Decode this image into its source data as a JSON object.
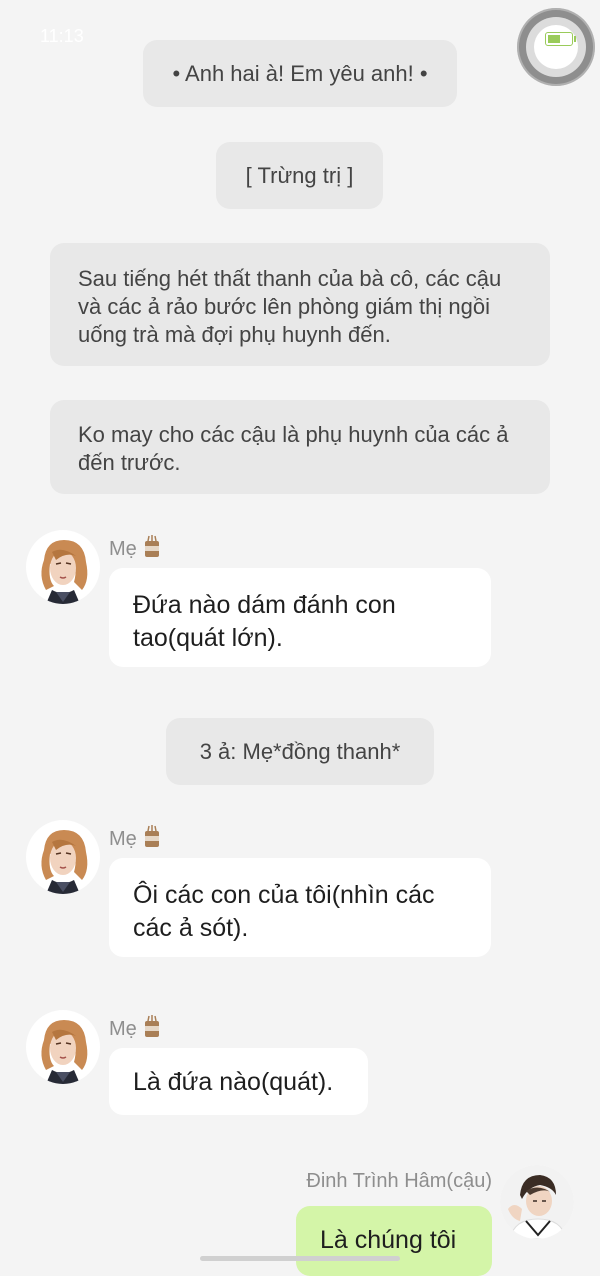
{
  "status_bar": {
    "time": "11:13"
  },
  "narrations": [
    "• Anh hai à! Em yêu anh! •",
    "[ Trừng trị ]",
    "Sau tiếng hét thất thanh của bà cô, các cậu và các ả rảo bước lên phòng giám thị ngồi uống trà mà đợi phụ huynh đến.",
    "Ko may cho các cậu là phụ huynh của các ả đến trước.",
    "3 ả: Mẹ*đồng thanh*"
  ],
  "messages": [
    {
      "sender": "Mẹ",
      "text": "Đứa nào dám đánh con tao(quát lớn)."
    },
    {
      "sender": "Mẹ",
      "text": "Ôi các con của tôi(nhìn các các ả sót)."
    },
    {
      "sender": "Mẹ",
      "text": "Là đứa nào(quát)."
    },
    {
      "sender": "Đinh Trình Hâm(cậu)",
      "text": "Là chúng tôi"
    }
  ],
  "icons": {
    "sender_badge": "coffee-cup-icon",
    "floating_button": "assistive-touch-icon",
    "battery": "battery-icon"
  },
  "colors": {
    "background": "#f4f4f4",
    "narration_bg": "#e8e8e8",
    "bubble_bg": "#ffffff",
    "my_bubble_bg": "#d4f5a8"
  }
}
